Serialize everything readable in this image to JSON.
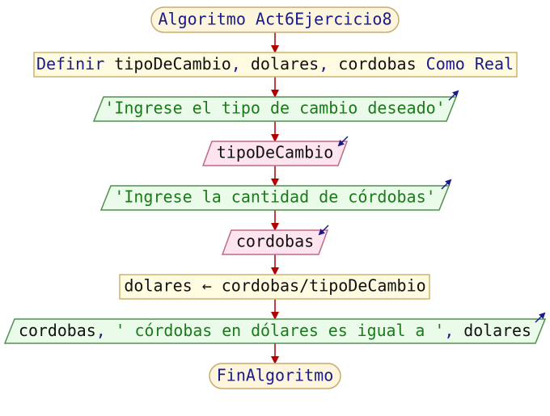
{
  "flowchart": {
    "start_label": "Algoritmo Act6Ejercicio8",
    "define": {
      "keyword": "Definir",
      "names": [
        "tipoDeCambio",
        "dolares",
        "cordobas"
      ],
      "separator": ", ",
      "type_keyword": "Como Real"
    },
    "output1": "'Ingrese el tipo de cambio deseado'",
    "input1": "tipoDeCambio",
    "output2": "'Ingrese la cantidad de córdobas'",
    "input2": "cordobas",
    "assign": "dolares ← cordobas/tipoDeCambio",
    "output3": {
      "var1": "cordobas",
      "sep1": ", ",
      "string": "' córdobas en dólares es igual a '",
      "sep2": ", ",
      "var2": "dolares"
    },
    "end_label": "FinAlgoritmo"
  },
  "colors": {
    "terminal_fill": "#fef6dc",
    "terminal_stroke": "#c8aa6e",
    "process_fill": "#fffbe0",
    "process_stroke": "#c9b56d",
    "output_fill": "#eafbea",
    "output_stroke": "#4f8f4f",
    "input_fill": "#fde4ee",
    "input_stroke": "#c06a8a",
    "arrow": "#b00000",
    "keyword_text": "#1a1a8c",
    "string_text": "#1a7a1a",
    "plain_text": "#111111",
    "io_icon": "#1a1a8c"
  }
}
